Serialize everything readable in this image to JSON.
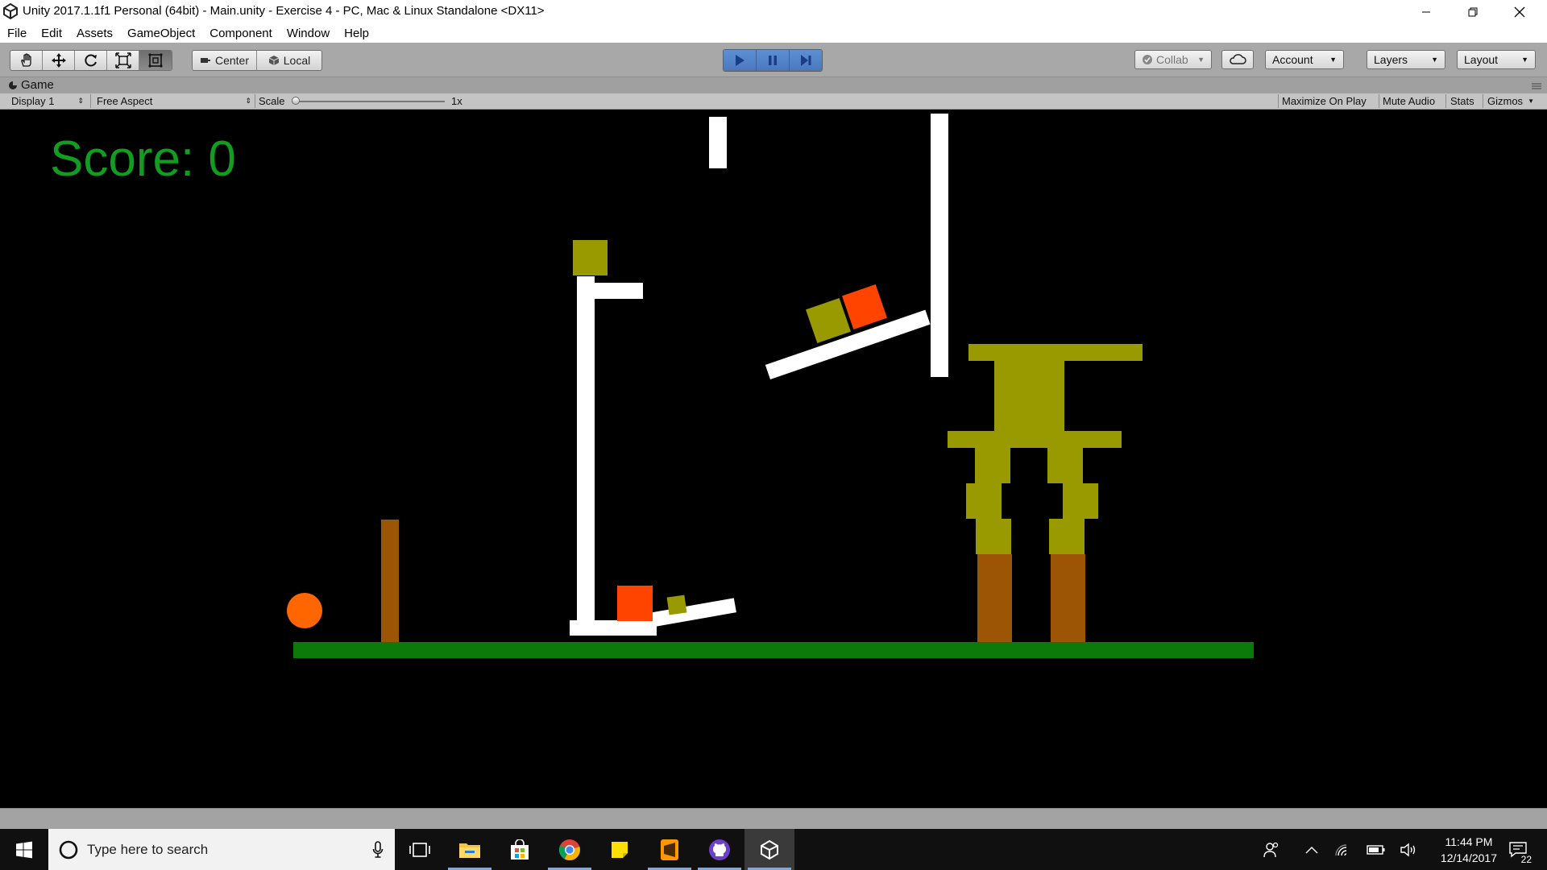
{
  "window": {
    "title": "Unity 2017.1.1f1 Personal (64bit) - Main.unity - Exercise 4 - PC, Mac & Linux Standalone <DX11>",
    "controls": [
      "minimize-icon",
      "restore-icon",
      "close-icon"
    ]
  },
  "menu": [
    "File",
    "Edit",
    "Assets",
    "GameObject",
    "Component",
    "Window",
    "Help"
  ],
  "toolbar": {
    "tools": [
      "hand-icon",
      "move-icon",
      "rotate-icon",
      "scale-icon",
      "rect-tool-icon"
    ],
    "active_tool": "rect-tool-icon",
    "pivot_label": "Center",
    "space_label": "Local",
    "play_controls": [
      "play-icon",
      "pause-icon",
      "step-icon"
    ],
    "collab_label": "Collab",
    "account_label": "Account",
    "layers_label": "Layers",
    "layout_label": "Layout"
  },
  "game_panel": {
    "tab_label": "Game",
    "display": "Display 1",
    "aspect": "Free Aspect",
    "scale_label": "Scale",
    "scale_value": "1x",
    "scale_slider_level": 0,
    "maximize_label": "Maximize On Play",
    "mute_label": "Mute Audio",
    "stats_label": "Stats",
    "gizmos_label": "Gizmos"
  },
  "game": {
    "score_text": "Score: 0",
    "colors": {
      "background": "#000000",
      "score": "#119d1f",
      "ground": "#0b7a0b",
      "wall": "#ffffff",
      "olive_block": "#999900",
      "orange_block": "#ff4400",
      "ball": "#ff6600",
      "wood": "#9b5505"
    }
  },
  "taskbar": {
    "search_placeholder": "Type here to search",
    "apps": [
      "task-view-icon",
      "file-explorer-icon",
      "store-icon",
      "chrome-icon",
      "sticky-notes-icon",
      "sublime-text-icon",
      "github-icon",
      "unity-icon"
    ],
    "time": "11:44 PM",
    "date": "12/14/2017",
    "notification_count": "22"
  }
}
